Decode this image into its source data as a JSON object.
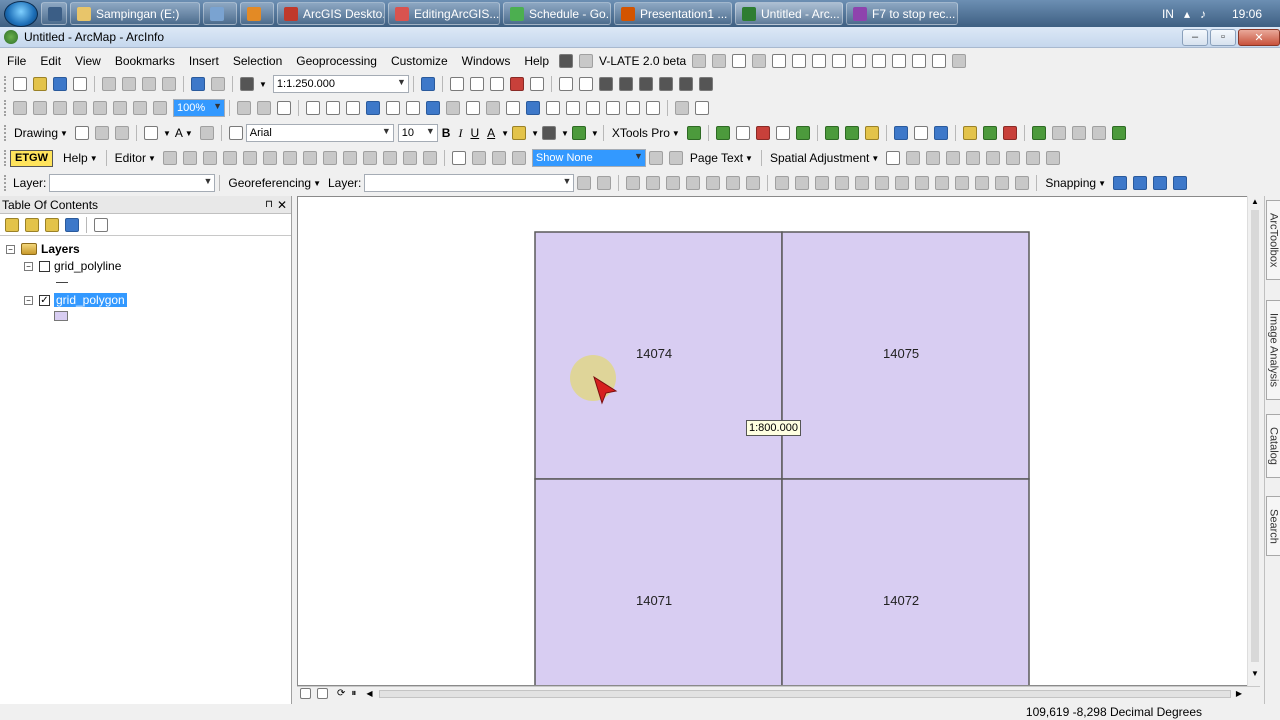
{
  "taskbar": {
    "items": [
      {
        "label": "",
        "color": "#3b5e86"
      },
      {
        "label": "Sampingan (E:)",
        "color": "#e8c56a"
      },
      {
        "label": "",
        "color": "#7aa3d1"
      },
      {
        "label": "",
        "color": "#e38a25"
      },
      {
        "label": "ArcGIS Deskto...",
        "color": "#c0392b"
      },
      {
        "label": "EditingArcGIS...",
        "color": "#d9534f"
      },
      {
        "label": "Schedule - Go...",
        "color": "#4caf50"
      },
      {
        "label": "Presentation1 ...",
        "color": "#d35400"
      },
      {
        "label": "Untitled - Arc...",
        "color": "#2e7d32"
      },
      {
        "label": "F7 to stop rec...",
        "color": "#8e44ad"
      }
    ],
    "lang": "IN",
    "clock": "19:06"
  },
  "window": {
    "title": "Untitled - ArcMap - ArcInfo",
    "min": "–",
    "max": "▫",
    "close": "✕"
  },
  "menu": {
    "items": [
      "File",
      "Edit",
      "View",
      "Bookmarks",
      "Insert",
      "Selection",
      "Geoprocessing",
      "Customize",
      "Windows",
      "Help"
    ],
    "vlate": "V-LATE 2.0 beta"
  },
  "toolbar1": {
    "scale": "1:1.250.000"
  },
  "toolbar2": {
    "zoom": "100%"
  },
  "toolbar3": {
    "drawing": "Drawing",
    "font": "Arial",
    "size": "10",
    "b": "B",
    "i": "I",
    "u": "U",
    "text_color": "A",
    "xtools": "XTools Pro"
  },
  "toolbar4": {
    "etgw": "ETGW",
    "help": "Help",
    "editor": "Editor",
    "show_none": "Show None",
    "page_text": "Page Text",
    "spatial_adjustment": "Spatial Adjustment"
  },
  "toolbar5": {
    "layer_label": "Layer:",
    "georef": "Georeferencing",
    "layer_label2": "Layer:",
    "snapping": "Snapping"
  },
  "toc": {
    "title": "Table Of Contents",
    "pin": "⊓",
    "close": "✕",
    "root": "Layers",
    "layers": [
      {
        "name": "grid_polyline",
        "checked": false
      },
      {
        "name": "grid_polygon",
        "checked": true
      }
    ]
  },
  "map": {
    "fill": "#d8cdf2",
    "stroke": "#5a5a5a",
    "cells": [
      "14074",
      "14075",
      "14071",
      "14072"
    ],
    "scale_tip": "1:800.000"
  },
  "dock": {
    "tabs": [
      "ArcToolbox",
      "Image Analysis",
      "Catalog",
      "Search"
    ]
  },
  "status": {
    "coords": "109,619  -8,298 Decimal Degrees"
  }
}
